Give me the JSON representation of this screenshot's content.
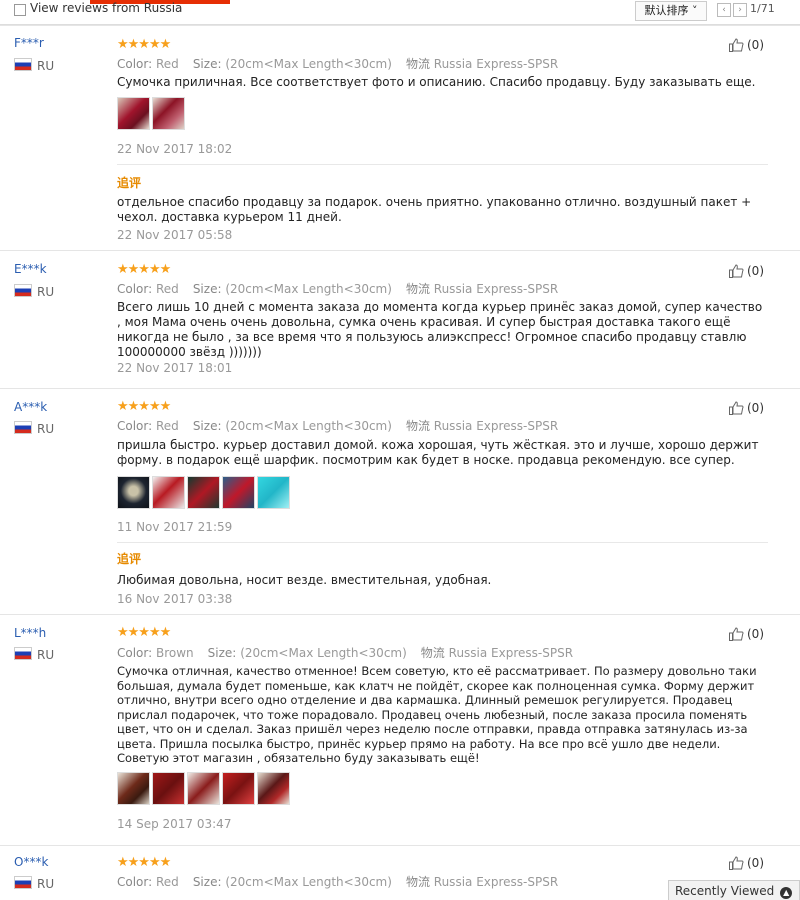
{
  "header": {
    "view_reviews_label": "View reviews from Russia",
    "sort_label": "默认排序 ˅",
    "prev_label": "‹",
    "next_label": "›",
    "page_count": "1/71"
  },
  "labels": {
    "color": "Color:",
    "size": "Size:",
    "logistics": "物流",
    "followup": "追评"
  },
  "reviews": [
    {
      "user": "F***r",
      "country": "RU",
      "stars": "★★★★★",
      "color": "Red",
      "size": "(20cm<Max Length<30cm)",
      "shipping": "Russia Express-SPSR",
      "likes": "(0)",
      "text": "Сумочка приличная. Все соответствует фото и описанию. Спасибо продавцу. Буду заказывать еще.",
      "date": "22 Nov 2017 18:02",
      "followup_text": "отдельное спасибо продавцу за подарок. очень приятно. упакованно отлично. воздушный пакет + чехол. доставка курьером 11 дней.",
      "followup_date": "22 Nov 2017 05:58"
    },
    {
      "user": "E***k",
      "country": "RU",
      "stars": "★★★★★",
      "color": "Red",
      "size": "(20cm<Max Length<30cm)",
      "shipping": "Russia Express-SPSR",
      "likes": "(0)",
      "text": "Всего лишь 10 дней с момента заказа до момента когда курьер принёс заказ домой, супер качество , моя Мама очень очень довольна, сумка очень красивая. И супер быстрая доставка такого ещё никогда не было , за все время что я пользуюсь алиэкспресс! Огромное спасибо продавцу ставлю 100000000 звёзд )))))))",
      "date": "22 Nov 2017 18:01"
    },
    {
      "user": "A***k",
      "country": "RU",
      "stars": "★★★★★",
      "color": "Red",
      "size": "(20cm<Max Length<30cm)",
      "shipping": "Russia Express-SPSR",
      "likes": "(0)",
      "text": "пришла быстро. курьер доставил домой. кожа хорошая, чуть жёсткая. это и лучше, хорошо держит форму. в подарок ещё шарфик. посмотрим как будет в носке. продавца рекомендую. все супер.",
      "date": "11 Nov 2017 21:59",
      "followup_text": "Любимая довольна, носит везде. вместительная, удобная.",
      "followup_date": "16 Nov 2017 03:38"
    },
    {
      "user": "L***h",
      "country": "RU",
      "stars": "★★★★★",
      "color": "Brown",
      "size": "(20cm<Max Length<30cm)",
      "shipping": "Russia Express-SPSR",
      "likes": "(0)",
      "text": "Сумочка отличная, качество отменное! Всем советую, кто её рассматривает. По размеру довольно таки большая, думала будет поменьше, как клатч не пойдёт, скорее как полноценная сумка. Форму держит отлично, внутри всего одно отделение и два кармашка. Длинный ремешок регулируется. Продавец прислал подарочек, что тоже порадовало. Продавец очень любезный, после заказа просила поменять цвет, что он и сделал. Заказ пришёл через неделю после отправки, правда отправка затянулась из-за цвета. Пришла посылка быстро, принёс курьер прямо на работу. На все про всё ушло две недели. Советую этот магазин , обязательно буду заказывать ещё!",
      "date": "14 Sep 2017 03:47"
    },
    {
      "user": "O***k",
      "country": "RU",
      "stars": "★★★★★",
      "color": "Red",
      "size": "(20cm<Max Length<30cm)",
      "shipping": "Russia Express-SPSR",
      "likes": "(0)"
    }
  ],
  "recently_viewed": "Recently Viewed",
  "colors": {
    "accent": "#e62e04",
    "star": "#f7a01c",
    "followup": "#e68a00",
    "username": "#2a5db0"
  }
}
